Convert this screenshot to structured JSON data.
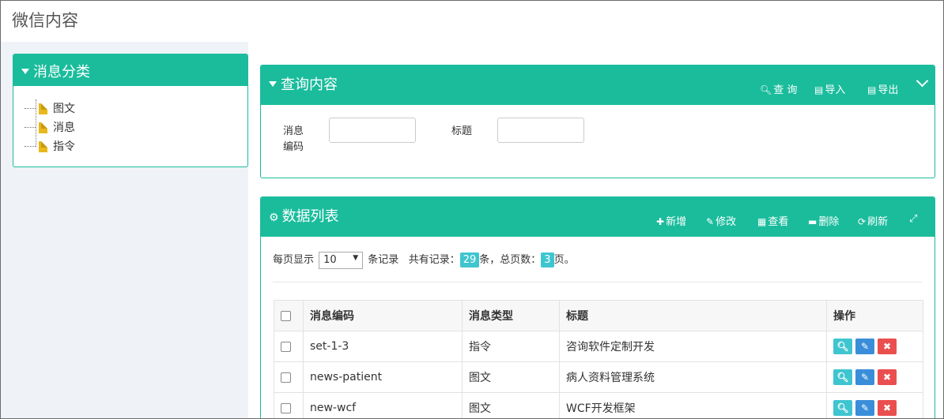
{
  "page": {
    "title": "微信内容"
  },
  "category_panel": {
    "title": "消息分类",
    "items": [
      {
        "label": "图文"
      },
      {
        "label": "消息"
      },
      {
        "label": "指令"
      }
    ]
  },
  "query_panel": {
    "title": "查询内容",
    "buttons": {
      "query": "查 询",
      "import": "导入",
      "export": "导出"
    },
    "fields": {
      "code_label_line1": "消息",
      "code_label_line2": "编码",
      "title_label": "标题",
      "code_value": "",
      "title_value": ""
    }
  },
  "data_panel": {
    "title": "数据列表",
    "buttons": {
      "add": "新增",
      "edit": "修改",
      "view": "查看",
      "delete": "删除",
      "refresh": "刷新"
    },
    "pager": {
      "per_page_prefix": "每页显示",
      "per_page_value": "10",
      "per_page_suffix": "条记录",
      "total_prefix": "共有记录：",
      "total_records": "29",
      "total_mid": "条，总页数：",
      "total_pages": "3",
      "total_suffix": "页。"
    },
    "columns": [
      "消息编码",
      "消息类型",
      "标题",
      "操作"
    ],
    "rows": [
      {
        "code": "set-1-3",
        "type": "指令",
        "title": "咨询软件定制开发"
      },
      {
        "code": "news-patient",
        "type": "图文",
        "title": "病人资料管理系统"
      },
      {
        "code": "new-wcf",
        "type": "图文",
        "title": "WCF开发框架"
      }
    ]
  },
  "colors": {
    "accent": "#1abc9c",
    "info": "#3fc5d0",
    "primary": "#3a8ed9",
    "danger": "#ea4f4f"
  },
  "icons": [
    "filter-icon",
    "file-icon",
    "search-icon",
    "import-icon",
    "export-icon",
    "chevron-down-icon",
    "gears-icon",
    "plus-icon",
    "pencil-icon",
    "table-icon",
    "minus-icon",
    "refresh-icon",
    "fullscreen-icon",
    "times-icon"
  ]
}
